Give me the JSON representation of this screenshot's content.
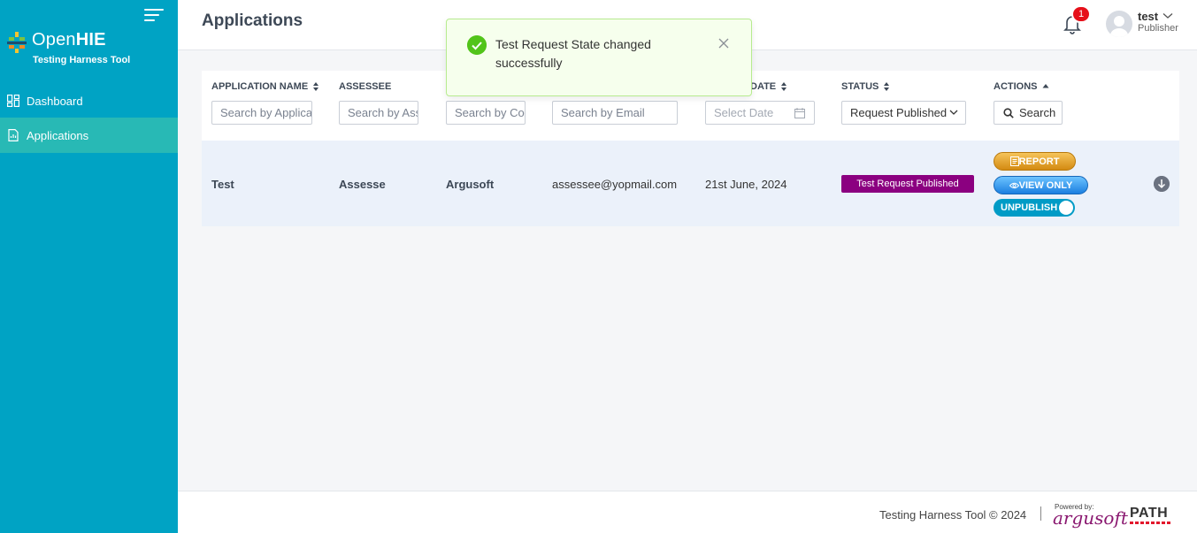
{
  "sidebar": {
    "logo": {
      "open": "Open",
      "hie": "HIE",
      "subtitle": "Testing Harness Tool"
    },
    "items": [
      {
        "label": "Dashboard",
        "icon": "dashboard-icon",
        "active": false
      },
      {
        "label": "Applications",
        "icon": "applications-icon",
        "active": true
      }
    ]
  },
  "header": {
    "title": "Applications",
    "notifications": {
      "count": "1",
      "icon": "bell-icon"
    },
    "user": {
      "name": "test",
      "role": "Publisher"
    }
  },
  "toast": {
    "message": "Test Request State changed successfully",
    "icon": "check-circle-icon"
  },
  "table": {
    "columns": [
      {
        "label": "APPLICATION NAME",
        "sortable": true
      },
      {
        "label": "ASSESSEE",
        "sortable": false
      },
      {
        "label": "",
        "sortable": false
      },
      {
        "label": "",
        "sortable": false
      },
      {
        "label": "DATE",
        "sortable": true
      },
      {
        "label": "STATUS",
        "sortable": true
      },
      {
        "label": "ACTIONS",
        "sortable": true
      }
    ],
    "filters": {
      "application_name": "Search by Application",
      "assessee": "Search by Assessee",
      "company": "Search by Company",
      "email": "Search by Email",
      "date": "Select Date",
      "status": "Request Published",
      "search_button": "Search"
    },
    "rows": [
      {
        "application_name": "Test",
        "assessee": "Assesse",
        "company": "Argusoft",
        "email": "assessee@yopmail.com",
        "date": "21st June, 2024",
        "status": "Test Request Published",
        "actions": {
          "report": "REPORT",
          "view_only": "VIEW ONLY",
          "unpublish": "UNPUBLISH"
        }
      }
    ]
  },
  "footer": {
    "text": "Testing Harness Tool © 2024",
    "powered_by": "Powered by:",
    "brand": "argusoft",
    "partner": "PATH"
  },
  "colors": {
    "sidebar": "#00a3c4",
    "sidebar_active": "#28b9b5",
    "status_tag": "#8b0080",
    "toast_bg": "#f6ffed",
    "success": "#52c41a",
    "badge": "#e6101a"
  }
}
